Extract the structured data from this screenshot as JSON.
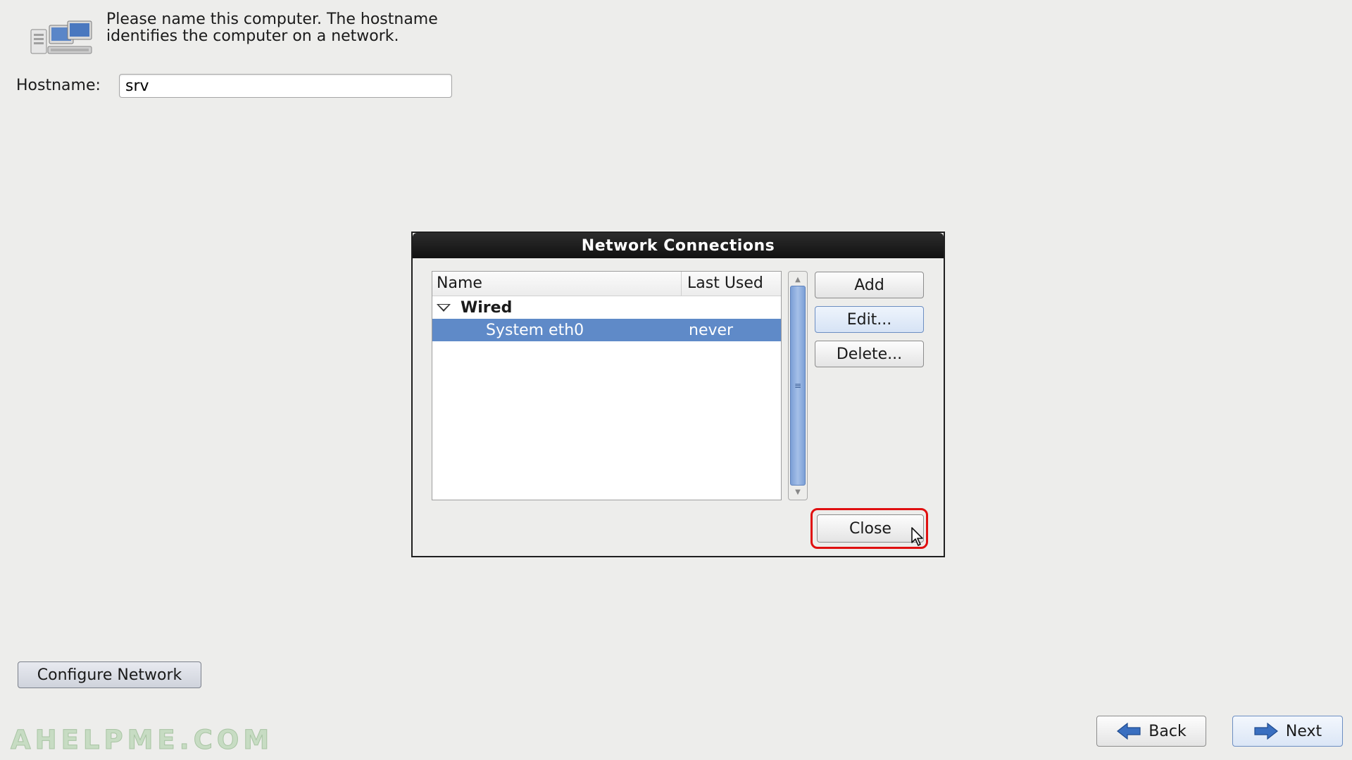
{
  "header": {
    "intro_text": "Please name this computer.  The hostname identifies the computer on a network.",
    "hostname_label": "Hostname:",
    "hostname_value": "srv"
  },
  "dialog": {
    "title": "Network Connections",
    "columns": {
      "name": "Name",
      "last_used": "Last Used"
    },
    "group": {
      "label": "Wired",
      "expanded": true
    },
    "connections": [
      {
        "name": "System eth0",
        "last_used": "never",
        "selected": true
      }
    ],
    "buttons": {
      "add": "Add",
      "edit": "Edit...",
      "delete": "Delete...",
      "close": "Close"
    },
    "highlighted_button": "close",
    "highlight_color": "#e01010",
    "selection_color": "#5f8ac8"
  },
  "footer": {
    "configure_network": "Configure Network",
    "back": "Back",
    "next": "Next",
    "watermark": "AHELPME.COM"
  },
  "icons": {
    "network_computers": "computer-network-icon",
    "back_arrow": "arrow-left-icon",
    "next_arrow": "arrow-right-icon",
    "expander": "triangle-down-icon",
    "cursor": "mouse-pointer-icon"
  }
}
